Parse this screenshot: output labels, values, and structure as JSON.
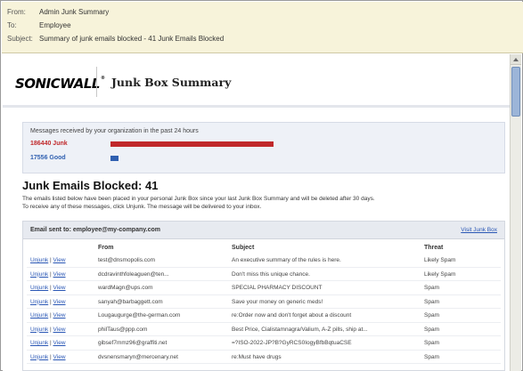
{
  "email_header": {
    "from_label": "From:",
    "from_value": "Admin Junk Summary",
    "to_label": "To:",
    "to_value": "Employee",
    "subject_label": "Subject:",
    "subject_value": "Summary of junk emails blocked - 41 Junk Emails Blocked"
  },
  "brand": {
    "logo": "SONICWALL",
    "title": "Junk Box Summary"
  },
  "stats": {
    "heading": "Messages received by your organization in the past 24 hours",
    "junk_label": "186440 Junk",
    "junk_color": "#c0282a",
    "junk_share": 0.914,
    "good_label": "17556 Good",
    "good_color": "#2f5fb0",
    "good_share": 0.086
  },
  "summary": {
    "title": "Junk Emails Blocked: 41",
    "line1": "The emails listed below have been placed in your personal Junk Box since your last Junk Box Summary and will be deleted after 30 days.",
    "line2": "To receive any of these messages, click Unjunk. The message will be delivered to your inbox."
  },
  "table": {
    "sent_to": "Email sent to: employee@my-company.com",
    "visit_link": "Visit Junk Box",
    "columns": [
      "From",
      "Subject",
      "Threat"
    ],
    "unjunk_label": "Unjunk",
    "view_label": "View",
    "rows": [
      {
        "from": "test@dnsmopolis.com",
        "subject": "An executive summary of the rules is here.",
        "threat": "Likely Spam"
      },
      {
        "from": "dcdravinthfoleaguen@ten...",
        "subject": "Don't miss this unique chance.",
        "threat": "Likely Spam"
      },
      {
        "from": "wardMagn@ups.com",
        "subject": "SPECIAL PHARMACY DISCOUNT",
        "threat": "Spam"
      },
      {
        "from": "sanyah@barbaggett.com",
        "subject": "Save your money on generic meds!",
        "threat": "Spam"
      },
      {
        "from": "Lougaugurge@the-german.com",
        "subject": "re:Order now and don't forget about a discount",
        "threat": "Spam"
      },
      {
        "from": "philTaus@ppp.com",
        "subject": "Best Price, Cialistamnagra/Valium, A-Z pills, ship at...",
        "threat": "Spam"
      },
      {
        "from": "gibsef7mmz96@graffiti.net",
        "subject": "=?ISO-2022-JP?B?GyRCS0IogyBfbBqtuaCSE",
        "threat": "Spam"
      },
      {
        "from": "dvsnensmaryn@mercenary.net",
        "subject": "re:Must have drugs",
        "threat": "Spam"
      }
    ]
  }
}
